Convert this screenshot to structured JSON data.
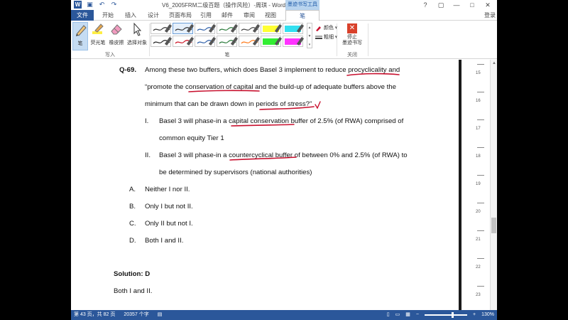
{
  "window": {
    "title": "V6_2005FRM二级百题（操作风险）-周琪 - Word",
    "context_tab_header": "墨迹书写工具",
    "login": "登录",
    "quick_access": {
      "word_icon": "word-logo",
      "save_icon": "save-icon",
      "undo_icon": "undo-icon",
      "redo_icon": "redo-icon"
    },
    "controls": {
      "help": "?",
      "restore": "▢",
      "minimize": "—",
      "maximize": "□",
      "close": "✕"
    }
  },
  "tabs": [
    {
      "label": "文件"
    },
    {
      "label": "开始"
    },
    {
      "label": "插入"
    },
    {
      "label": "设计"
    },
    {
      "label": "页面布局"
    },
    {
      "label": "引用"
    },
    {
      "label": "邮件"
    },
    {
      "label": "审阅"
    },
    {
      "label": "视图"
    },
    {
      "label": "笔"
    }
  ],
  "ribbon": {
    "write_group": {
      "label": "写入",
      "buttons": [
        {
          "label": "笔",
          "icon": "pen-icon"
        },
        {
          "label": "荧光笔",
          "icon": "highlighter-icon"
        },
        {
          "label": "橡皮擦",
          "icon": "eraser-icon"
        },
        {
          "label": "选择对象",
          "icon": "select-cursor-icon"
        }
      ]
    },
    "pens_group": {
      "label": "笔",
      "pens": [
        {
          "color": "#333333",
          "kind": "pen"
        },
        {
          "color": "#333333",
          "kind": "pen",
          "selected": true
        },
        {
          "color": "#2e5fa8",
          "kind": "pen"
        },
        {
          "color": "#2a7a3a",
          "kind": "pen"
        },
        {
          "color": "#444444",
          "kind": "pen"
        },
        {
          "color": "#ffff33",
          "kind": "highlighter"
        },
        {
          "color": "#33e0f0",
          "kind": "highlighter"
        },
        {
          "color": "#222222",
          "kind": "pen"
        },
        {
          "color": "#cc1122",
          "kind": "pen"
        },
        {
          "color": "#2e5fa8",
          "kind": "pen"
        },
        {
          "color": "#2a7a3a",
          "kind": "pen"
        },
        {
          "color": "#ff7a1a",
          "kind": "pen"
        },
        {
          "color": "#33ee33",
          "kind": "highlighter"
        },
        {
          "color": "#ff33ff",
          "kind": "highlighter"
        }
      ],
      "color_label": "颜色",
      "thickness_label": "粗细"
    },
    "close_group": {
      "label": "关闭",
      "stop_label_1": "停止",
      "stop_label_2": "墨迹书写"
    }
  },
  "document": {
    "q_number": "Q-69.",
    "q_line1": "Among these two buffers, which does Basel 3 implement to reduce procyclicality and",
    "q_line2": "“promote the conservation of capital and the build-up of adequate buffers above the",
    "q_line3": "minimum that can be drawn down in periods of stress?”",
    "stmt1_num": "I.",
    "stmt1_line1": "Basel 3 will phase-in a capital conservation buffer of 2.5% (of RWA) comprised of",
    "stmt1_line2": "common equity Tier 1",
    "stmt2_num": "II.",
    "stmt2_line1": "Basel 3 will phase-in a countercyclical buffer of between 0% and 2.5% (of RWA) to",
    "stmt2_line2": "be determined by supervisors (national authorities)",
    "options": [
      {
        "letter": "A.",
        "text": "Neither I nor II."
      },
      {
        "letter": "B.",
        "text": "Only I but not II."
      },
      {
        "letter": "C.",
        "text": "Only II but not I."
      },
      {
        "letter": "D.",
        "text": "Both I and II."
      }
    ],
    "solution": "Solution: D",
    "solution_text": "Both I and II.",
    "ink_color": "#c8102e"
  },
  "ruler": [
    "15",
    "16",
    "17",
    "18",
    "19",
    "20",
    "21",
    "22",
    "23"
  ],
  "status": {
    "page": "第 43 页，共 82 页",
    "words": "20357 个字",
    "zoom": "130%",
    "zoom_level_pct": 67
  }
}
